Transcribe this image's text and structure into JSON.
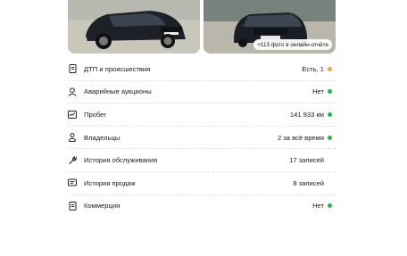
{
  "colors": {
    "ok": "#2db34a",
    "warn": "#f5a623"
  },
  "photos": {
    "more_badge": "+113 фото в онлайн-отчёте"
  },
  "report": [
    {
      "icon": "document-icon",
      "label": "ДТП и происшествия",
      "value": "Есть, 1",
      "status": "warn"
    },
    {
      "icon": "gavel-person-icon",
      "label": "Аварийные аукционы",
      "value": "Нет",
      "status": "ok"
    },
    {
      "icon": "odometer-icon",
      "label": "Пробег",
      "value": "141 933 км",
      "status": "ok"
    },
    {
      "icon": "person-icon",
      "label": "Владельцы",
      "value": "2 за всё время",
      "status": "ok"
    },
    {
      "icon": "wrench-icon",
      "label": "История обслуживания",
      "value": "17 записей",
      "status": "none"
    },
    {
      "icon": "receipt-icon",
      "label": "История продаж",
      "value": "8 записей",
      "status": "none"
    },
    {
      "icon": "document-icon",
      "label": "Коммерция",
      "value": "Нет",
      "status": "ok"
    }
  ]
}
